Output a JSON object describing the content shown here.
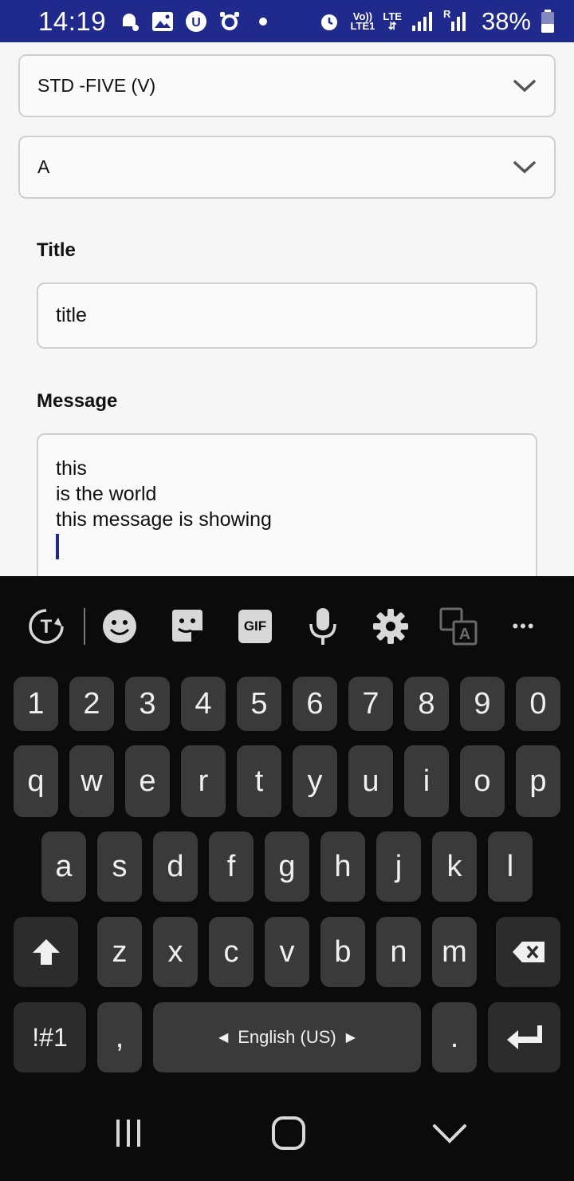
{
  "status_bar": {
    "time": "14:19",
    "network_top": "Vo))",
    "network_bottom": "LTE1",
    "lte": "LTE",
    "roaming": "R",
    "battery": "38%"
  },
  "form": {
    "class_dropdown": "STD -FIVE (V)",
    "section_dropdown": "A",
    "title_label": "Title",
    "title_value": "title",
    "message_label": "Message",
    "message_lines": [
      "this",
      "is the world",
      "this message is showing"
    ]
  },
  "keyboard": {
    "toolbar_icons": [
      "translate-text-icon",
      "emoji-icon",
      "sticker-icon",
      "gif-icon",
      "microphone-icon",
      "settings-icon",
      "translate-icon",
      "more-icon"
    ],
    "gif_label": "GIF",
    "more_label": "•••",
    "row_numbers": [
      "1",
      "2",
      "3",
      "4",
      "5",
      "6",
      "7",
      "8",
      "9",
      "0"
    ],
    "row_top": [
      "q",
      "w",
      "e",
      "r",
      "t",
      "y",
      "u",
      "i",
      "o",
      "p"
    ],
    "row_middle": [
      "a",
      "s",
      "d",
      "f",
      "g",
      "h",
      "j",
      "k",
      "l"
    ],
    "row_bottom": [
      "z",
      "x",
      "c",
      "v",
      "b",
      "n",
      "m"
    ],
    "symbols_key": "!#1",
    "comma_key": ",",
    "space_label": "English (US)",
    "period_key": "."
  },
  "nav_bar": {
    "icons": [
      "recents-icon",
      "home-icon",
      "back-icon"
    ]
  }
}
